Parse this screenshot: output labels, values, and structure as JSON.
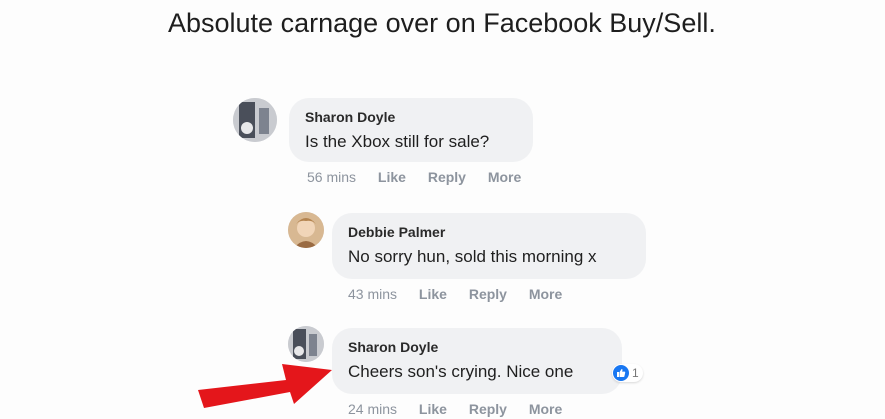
{
  "caption": "Absolute carnage over on Facebook Buy/Sell.",
  "comments": [
    {
      "author": "Sharon Doyle",
      "text": "Is the Xbox still for sale?",
      "time": "56 mins",
      "actions": [
        "Like",
        "Reply",
        "More"
      ]
    },
    {
      "author": "Debbie Palmer",
      "text": "No sorry hun, sold this morning x",
      "time": "43 mins",
      "actions": [
        "Like",
        "Reply",
        "More"
      ]
    },
    {
      "author": "Sharon Doyle",
      "text": "Cheers son's crying. Nice one",
      "time": "24 mins",
      "actions": [
        "Like",
        "Reply",
        "More"
      ],
      "reaction_icon": "thumbs-up-icon",
      "reaction_count": "1"
    }
  ],
  "colors": {
    "bubble": "#f0f1f3",
    "meta": "#8d949e",
    "like_blue": "#1877f2",
    "arrow_red": "#e4161b"
  }
}
